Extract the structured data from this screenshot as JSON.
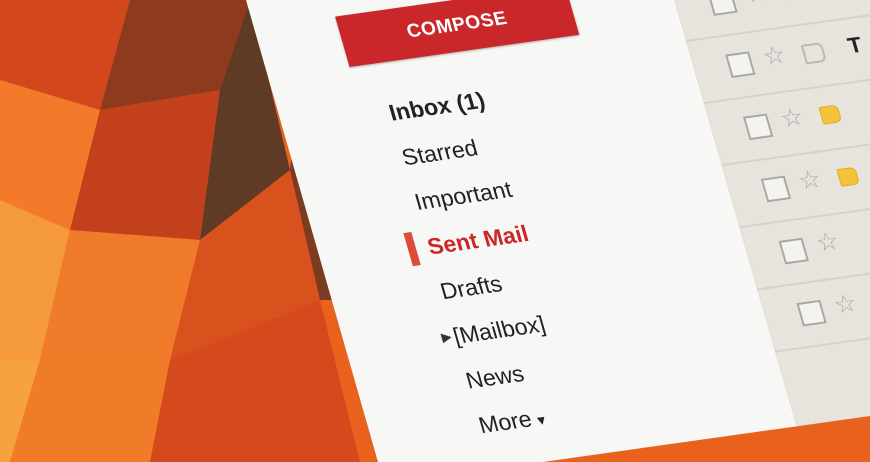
{
  "compose": {
    "label": "COMPOSE"
  },
  "nav": {
    "inbox": "Inbox (1)",
    "starred": "Starred",
    "important": "Important",
    "sent_mail": "Sent Mail",
    "drafts": "Drafts",
    "mailbox": "[Mailbox]",
    "news": "News",
    "more": "More"
  },
  "messages": [
    {
      "tag": "none",
      "sender": ""
    },
    {
      "tag": "filled",
      "sender": "To"
    },
    {
      "tag": "outline",
      "sender": "T"
    },
    {
      "tag": "filled",
      "sender": ""
    },
    {
      "tag": "filled",
      "sender": ""
    },
    {
      "tag": "none",
      "sender": ""
    },
    {
      "tag": "none",
      "sender": ""
    }
  ],
  "colors": {
    "compose_red": "#c9272a",
    "sent_mail_red": "#c9272a",
    "label_yellow": "#f5c33b",
    "wallpaper_orange": "#e8621e"
  },
  "icons": {
    "checkbox": "checkbox-icon",
    "star": "star-icon",
    "label": "label-tag-icon",
    "expand": "expand-arrow-icon",
    "more": "caret-down-icon"
  }
}
